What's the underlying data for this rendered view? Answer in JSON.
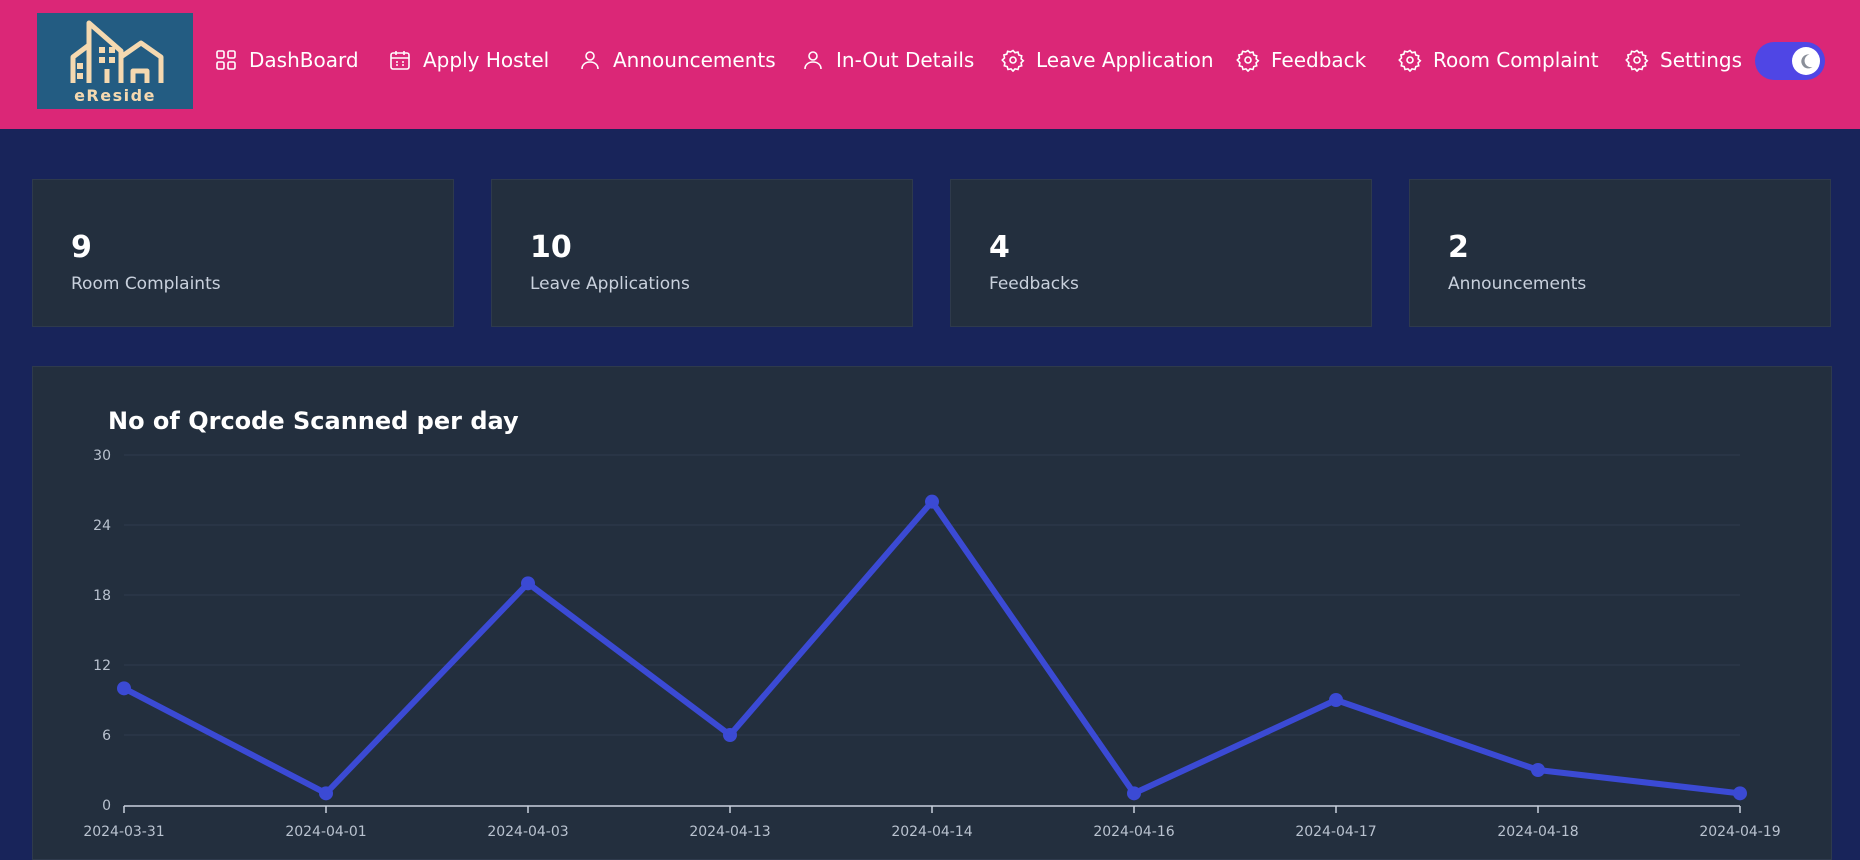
{
  "app": {
    "logo_text": "eReside"
  },
  "nav": {
    "items": [
      {
        "label": "DashBoard",
        "icon": "grid-icon"
      },
      {
        "label": "Apply Hostel",
        "icon": "calendar-icon"
      },
      {
        "label": "Announcements",
        "icon": "user-icon"
      },
      {
        "label": "In-Out Details",
        "icon": "user-icon"
      },
      {
        "label": "Leave Application",
        "icon": "gear-icon"
      },
      {
        "label": "Feedback",
        "icon": "gear-icon"
      },
      {
        "label": "Room Complaint",
        "icon": "gear-icon"
      },
      {
        "label": "Settings",
        "icon": "gear-icon"
      }
    ],
    "theme_toggle": {
      "icon": "moon-icon",
      "state": "dark"
    }
  },
  "stats": [
    {
      "value": "9",
      "label": "Room Complaints"
    },
    {
      "value": "10",
      "label": "Leave Applications"
    },
    {
      "value": "4",
      "label": "Feedbacks"
    },
    {
      "value": "2",
      "label": "Announcements"
    }
  ],
  "colors": {
    "header": "#db2777",
    "background": "#18245a",
    "card": "#232f3e",
    "series": "#3b4ad4"
  },
  "chart_data": {
    "type": "line",
    "title": "No of Qrcode Scanned per day",
    "categories": [
      "2024-03-31",
      "2024-04-01",
      "2024-04-03",
      "2024-04-13",
      "2024-04-14",
      "2024-04-16",
      "2024-04-17",
      "2024-04-18",
      "2024-04-19"
    ],
    "series": [
      {
        "values": [
          10,
          1,
          19,
          6,
          26,
          1,
          9,
          3,
          1
        ]
      }
    ],
    "yticks": [
      "0",
      "6",
      "12",
      "18",
      "24",
      "30"
    ],
    "ylim": [
      0,
      30
    ],
    "grid": true,
    "legend": false
  }
}
